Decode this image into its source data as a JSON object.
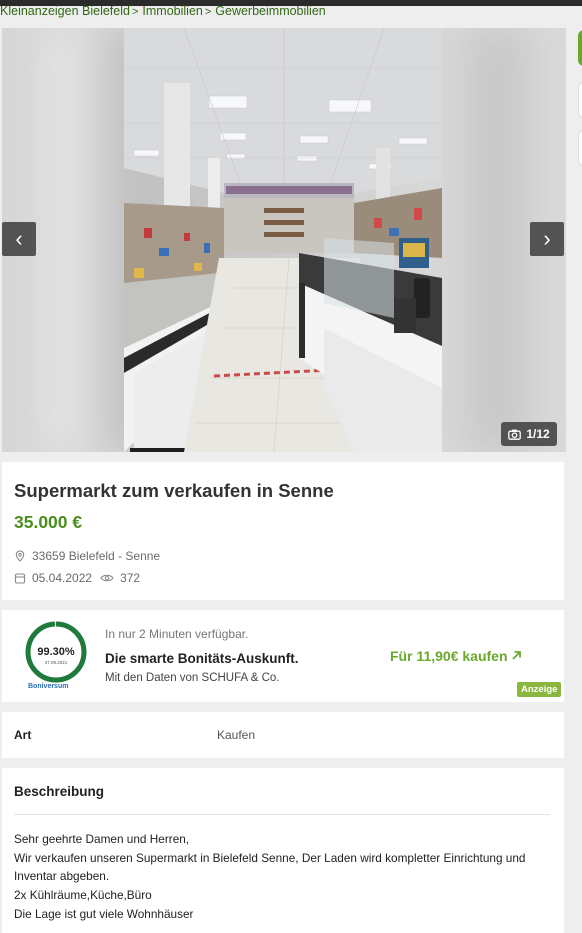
{
  "breadcrumb": [
    "Kleinanzeigen Bielefeld",
    "Immobilien",
    "Gewerbeimmobilien"
  ],
  "breadcrumb_separator": ">",
  "gallery": {
    "prev_icon": "chevron-left-icon",
    "next_icon": "chevron-right-icon",
    "prev_glyph": "‹",
    "next_glyph": "›",
    "counter_icon": "camera-icon",
    "counter": "1/12"
  },
  "listing": {
    "title": "Supermarkt zum verkaufen in Senne",
    "price": "35.000 €",
    "location": "33659 Bielefeld - Senne",
    "location_icon": "location-pin-icon",
    "date": "05.04.2022",
    "date_icon": "calendar-icon",
    "views": "372",
    "views_icon": "eye-icon"
  },
  "ad": {
    "seal_percent": "99.30%",
    "seal_date": "27.09.2021",
    "seal_brand": "Boniversum",
    "subtitle": "In nur 2 Minuten verfügbar.",
    "headline": "Die smarte Bonitäts-Auskunft.",
    "line": "Mit den Daten von SCHUFA & Co.",
    "cta": "Für 11,90€ kaufen",
    "cta_icon": "arrow-up-right-icon",
    "badge": "Anzeige"
  },
  "details": {
    "label": "Art",
    "value": "Kaufen"
  },
  "description": {
    "title": "Beschreibung",
    "lines": [
      "Sehr geehrte Damen und Herren,",
      "Wir verkaufen unseren Supermarkt in Bielefeld Senne, Der Laden wird kompletter Einrichtung und",
      "Inventar abgeben.",
      "2x Kühlräume,Küche,Büro",
      "Die Lage ist gut viele Wohnhäuser"
    ]
  },
  "colors": {
    "brand_green": "#326916",
    "price_green": "#4b8d1f",
    "cta_green": "#6aa82c",
    "seal_green": "#1f7a3c"
  }
}
